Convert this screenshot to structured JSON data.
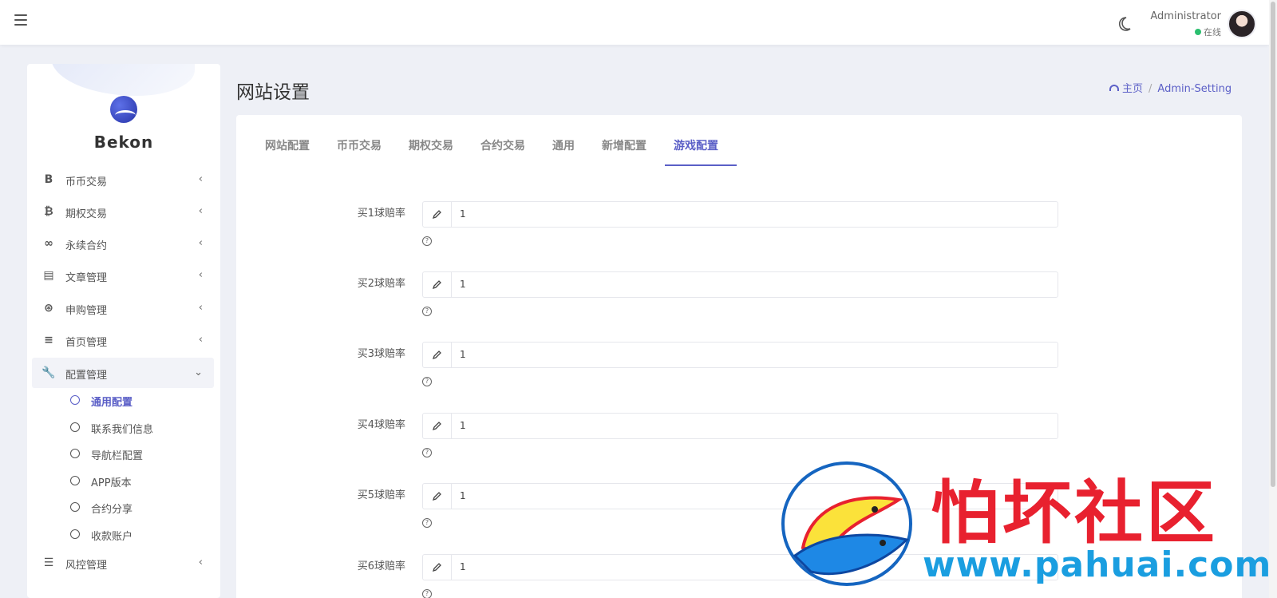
{
  "topbar": {
    "user_name": "Administrator",
    "user_status": "在线"
  },
  "sidebar": {
    "brand": "Bekon",
    "items": [
      {
        "label": "币币交易",
        "icon": "B"
      },
      {
        "label": "期权交易",
        "icon": "₿"
      },
      {
        "label": "永续合约",
        "icon": "∞"
      },
      {
        "label": "文章管理",
        "icon": "▤"
      },
      {
        "label": "申购管理",
        "icon": "⊛"
      },
      {
        "label": "首页管理",
        "icon": "≡"
      },
      {
        "label": "配置管理",
        "icon": "🔧"
      },
      {
        "label": "风控管理",
        "icon": "☰"
      }
    ],
    "subitems": [
      {
        "label": "通用配置"
      },
      {
        "label": "联系我们信息"
      },
      {
        "label": "导航栏配置"
      },
      {
        "label": "APP版本"
      },
      {
        "label": "合约分享"
      },
      {
        "label": "收款账户"
      }
    ]
  },
  "page": {
    "title": "网站设置",
    "breadcrumb_home": "主页",
    "breadcrumb_current": "Admin-Setting"
  },
  "tabs": [
    {
      "label": "网站配置"
    },
    {
      "label": "币币交易"
    },
    {
      "label": "期权交易"
    },
    {
      "label": "合约交易"
    },
    {
      "label": "通用"
    },
    {
      "label": "新增配置"
    },
    {
      "label": "游戏配置"
    }
  ],
  "fields": [
    {
      "label": "买1球赔率",
      "value": "1"
    },
    {
      "label": "买2球赔率",
      "value": "1"
    },
    {
      "label": "买3球赔率",
      "value": "1"
    },
    {
      "label": "买4球赔率",
      "value": "1"
    },
    {
      "label": "买5球赔率",
      "value": "1"
    },
    {
      "label": "买6球赔率",
      "value": "1"
    }
  ],
  "watermark": {
    "text": "怕坏社区",
    "url": "www.pahuai.com"
  },
  "colors": {
    "accent": "#5b5fc7",
    "online": "#2bbf6f"
  }
}
